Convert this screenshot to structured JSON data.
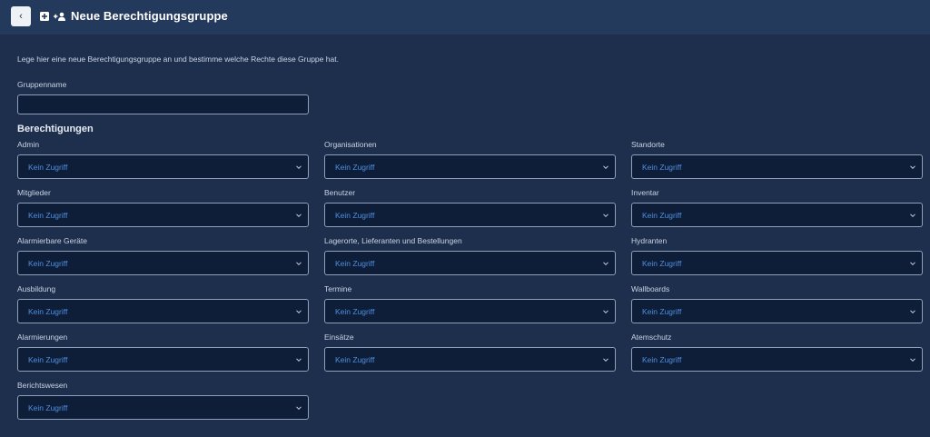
{
  "header": {
    "back_label": "‹",
    "title": "Neue Berechtigungsgruppe"
  },
  "intro": "Lege hier eine neue Berechtigungsgruppe an und bestimme welche Rechte diese Gruppe hat.",
  "groupname": {
    "label": "Gruppenname",
    "value": ""
  },
  "permissions_title": "Berechtigungen",
  "permissions": [
    {
      "label": "Admin",
      "value": "Kein Zugriff"
    },
    {
      "label": "Organisationen",
      "value": "Kein Zugriff"
    },
    {
      "label": "Standorte",
      "value": "Kein Zugriff"
    },
    {
      "label": "Mitglieder",
      "value": "Kein Zugriff"
    },
    {
      "label": "Benutzer",
      "value": "Kein Zugriff"
    },
    {
      "label": "Inventar",
      "value": "Kein Zugriff"
    },
    {
      "label": "Alarmierbare Geräte",
      "value": "Kein Zugriff"
    },
    {
      "label": "Lagerorte, Lieferanten und Bestellungen",
      "value": "Kein Zugriff"
    },
    {
      "label": "Hydranten",
      "value": "Kein Zugriff"
    },
    {
      "label": "Ausbildung",
      "value": "Kein Zugriff"
    },
    {
      "label": "Termine",
      "value": "Kein Zugriff"
    },
    {
      "label": "Wallboards",
      "value": "Kein Zugriff"
    },
    {
      "label": "Alarmierungen",
      "value": "Kein Zugriff"
    },
    {
      "label": "Einsätze",
      "value": "Kein Zugriff"
    },
    {
      "label": "Atemschutz",
      "value": "Kein Zugriff"
    },
    {
      "label": "Berichtswesen",
      "value": "Kein Zugriff"
    }
  ],
  "colors": {
    "page_bg": "#1e2f4e",
    "header_bg": "#243a5c",
    "field_bg": "#0f1e38",
    "select_text": "#4e8fe0"
  }
}
